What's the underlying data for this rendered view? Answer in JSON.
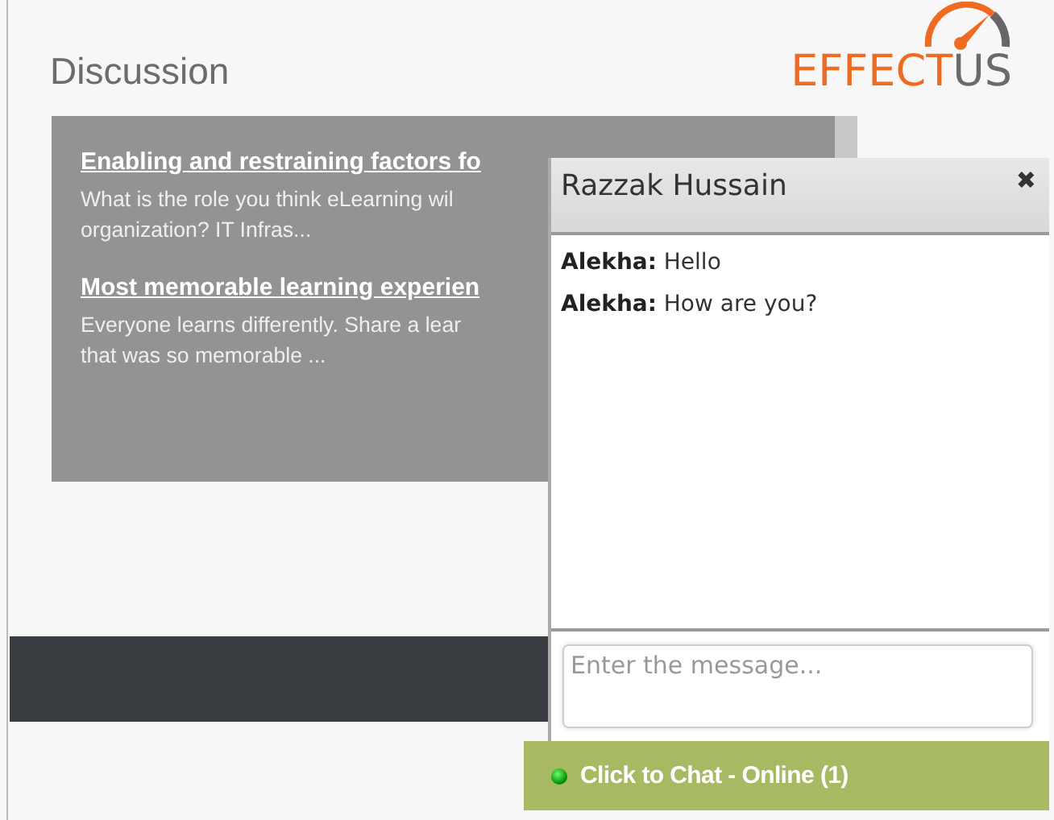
{
  "page": {
    "title": "Discussion"
  },
  "logo": {
    "part_1": "EFFECT",
    "part_2": "US"
  },
  "topics": [
    {
      "title": "Enabling and restraining factors fo",
      "excerpt_lines": [
        "What is the role you think eLearning wil",
        "organization? IT Infras..."
      ]
    },
    {
      "title": "Most memorable learning experien",
      "excerpt_lines": [
        "Everyone learns differently. Share a lear",
        "that was so memorable ..."
      ]
    }
  ],
  "chat": {
    "contact": "Razzak Hussain",
    "close_icon": "✖",
    "messages": [
      {
        "sender": "Alekha:",
        "text": "Hello"
      },
      {
        "sender": "Alekha:",
        "text": "How are you?"
      }
    ],
    "input": {
      "placeholder": "Enter the message..."
    }
  },
  "chat_bar": {
    "label": "Click to Chat - Online (1)",
    "online": true
  }
}
